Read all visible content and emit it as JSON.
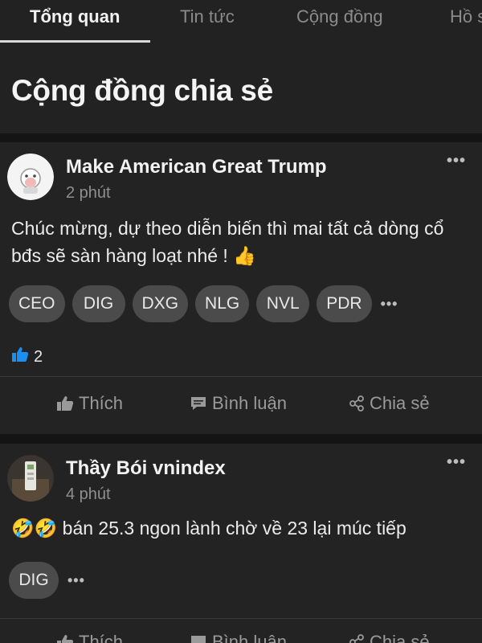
{
  "tabs": [
    {
      "label": "Tổng quan",
      "active": true
    },
    {
      "label": "Tin tức",
      "active": false
    },
    {
      "label": "Cộng đồng",
      "active": false
    },
    {
      "label": "Hồ s",
      "active": false
    }
  ],
  "header": {
    "title": "Cộng đồng chia sẻ"
  },
  "posts": [
    {
      "author": "Make American Great Trump",
      "time": "2 phút",
      "content": "Chúc mừng, dự theo diễn biến thì mai tất cả dòng cổ bđs sẽ sàn hàng loạt nhé ! 👍",
      "tags": [
        "CEO",
        "DIG",
        "DXG",
        "NLG",
        "NVL",
        "PDR"
      ],
      "tags_more": "•••",
      "likes": "2"
    },
    {
      "author": "Thầy Bói vnindex",
      "time": "4 phút",
      "content": "🤣🤣 bán 25.3 ngon lành chờ về 23 lại múc tiếp",
      "tags": [
        "DIG"
      ],
      "tags_more": "•••"
    }
  ],
  "actions": {
    "like": "Thích",
    "comment": "Bình luận",
    "share": "Chia sẻ"
  },
  "more_label": "•••",
  "colors": {
    "background": "#141414",
    "card": "#232323",
    "tag": "#4b4b4b",
    "like_blue": "#1b8ef0"
  }
}
